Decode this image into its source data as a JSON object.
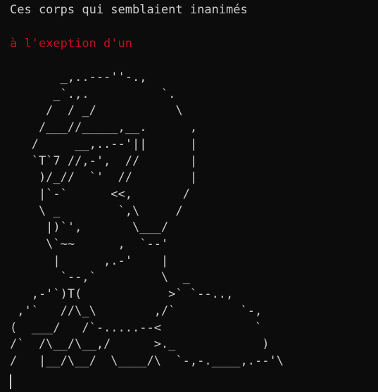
{
  "terminal": {
    "line1": "Ces corps qui semblaient inanimés",
    "line2": "à l'exeption d'un",
    "art": "       _,..---''-.,\n      _`.,.          `.\n     /  / _/           \\\n    /___//_____,__.      ,\n   /     __,..--'||      |\n   `T`7 //,-',  //       |\n    )/_//  `'  //        |\n    |`-`      <<,       /\n    \\ _        `,\\     /\n     |)`',       \\___/\n     \\`~~      ,  `--'\n      |      ,.-'    |\n       `--,`         \\  _\n   ,-'`)T(            >` `--..,\n ,'`   //\\_\\        ,/`         `-,\n(  ___/   /`-.....--<             `\n/`  /\\__/\\__,/      >._            )\n/   |__/\\__/  \\____/\\  `-,-.____,.--'\\",
    "colors": {
      "background": "#0c0c0c",
      "foreground": "#cccccc",
      "accent_red": "#c50f1f"
    }
  }
}
